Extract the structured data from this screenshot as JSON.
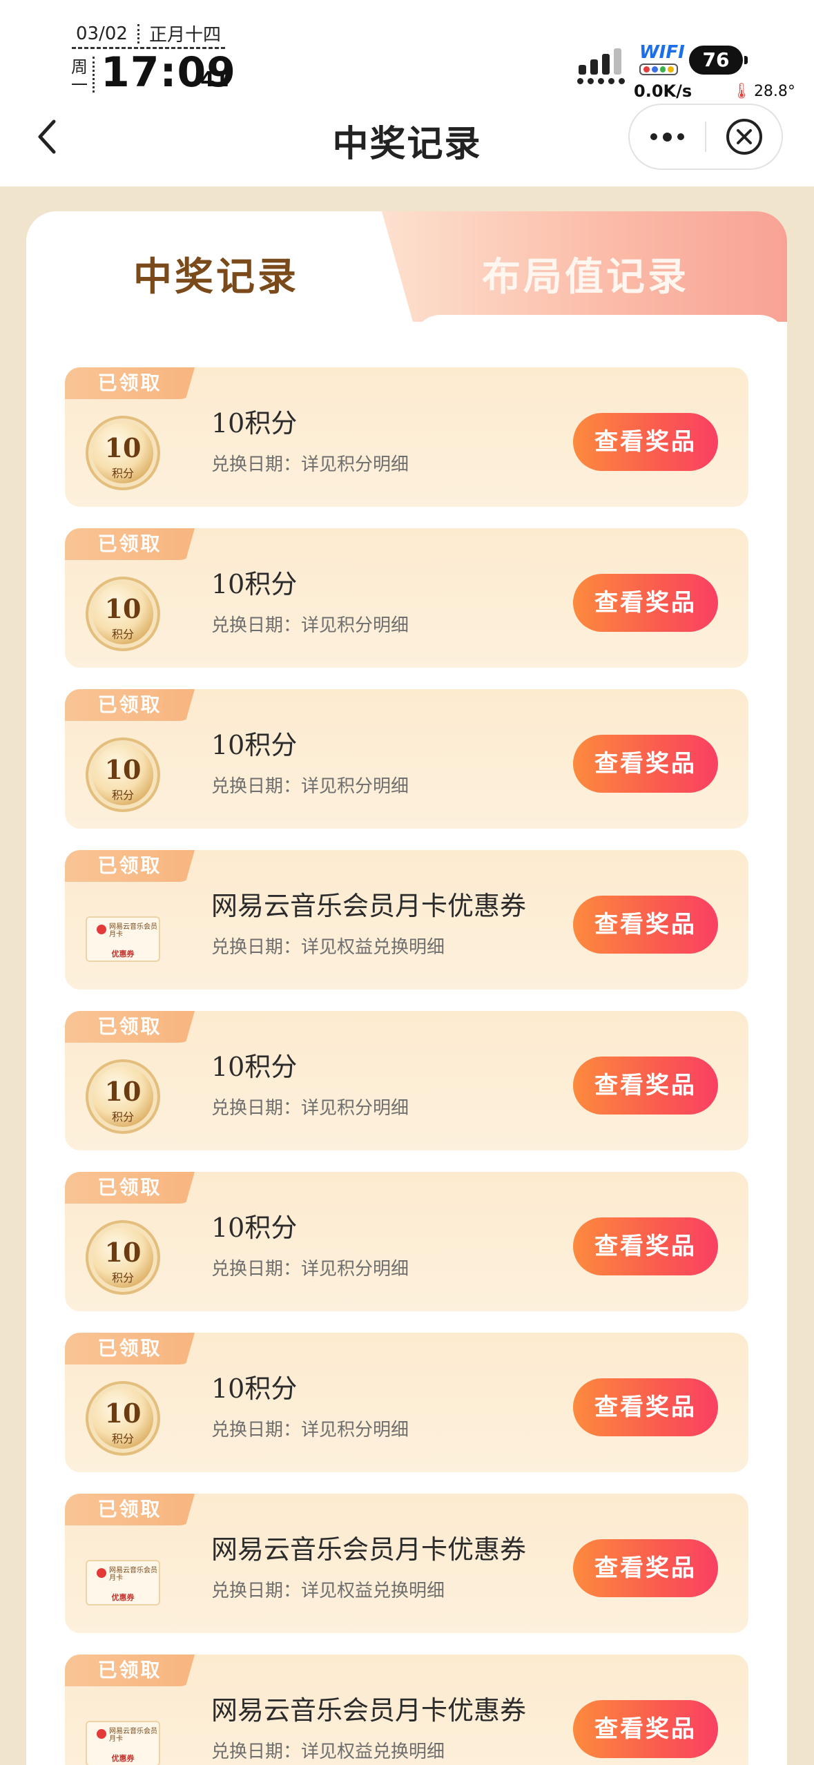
{
  "status_bar": {
    "date": "03/02",
    "lunar": "正月十四",
    "weekday": "周一",
    "time": "17:09",
    "seconds": "41",
    "wifi_label": "WIFI",
    "battery": "76",
    "net_speed": "0.0K/s",
    "temperature": "28.8°"
  },
  "header": {
    "title": "中奖记录"
  },
  "tabs": {
    "active": "中奖记录",
    "inactive": "布局值记录"
  },
  "voucher_thumb": {
    "name": "网易云音乐会员月卡",
    "tag": "优惠券"
  },
  "records": [
    {
      "type": "coin",
      "badge": "已领取",
      "coin_value": "10",
      "coin_unit": "积分",
      "title": "10积分",
      "subtitle": "兑换日期：详见积分明细",
      "button": "查看奖品"
    },
    {
      "type": "coin",
      "badge": "已领取",
      "coin_value": "10",
      "coin_unit": "积分",
      "title": "10积分",
      "subtitle": "兑换日期：详见积分明细",
      "button": "查看奖品"
    },
    {
      "type": "coin",
      "badge": "已领取",
      "coin_value": "10",
      "coin_unit": "积分",
      "title": "10积分",
      "subtitle": "兑换日期：详见积分明细",
      "button": "查看奖品"
    },
    {
      "type": "voucher",
      "badge": "已领取",
      "title": "网易云音乐会员月卡优惠券",
      "subtitle": "兑换日期：详见权益兑换明细",
      "button": "查看奖品"
    },
    {
      "type": "coin",
      "badge": "已领取",
      "coin_value": "10",
      "coin_unit": "积分",
      "title": "10积分",
      "subtitle": "兑换日期：详见积分明细",
      "button": "查看奖品"
    },
    {
      "type": "coin",
      "badge": "已领取",
      "coin_value": "10",
      "coin_unit": "积分",
      "title": "10积分",
      "subtitle": "兑换日期：详见积分明细",
      "button": "查看奖品"
    },
    {
      "type": "coin",
      "badge": "已领取",
      "coin_value": "10",
      "coin_unit": "积分",
      "title": "10积分",
      "subtitle": "兑换日期：详见积分明细",
      "button": "查看奖品"
    },
    {
      "type": "voucher",
      "badge": "已领取",
      "title": "网易云音乐会员月卡优惠券",
      "subtitle": "兑换日期：详见权益兑换明细",
      "button": "查看奖品"
    },
    {
      "type": "voucher",
      "badge": "已领取",
      "title": "网易云音乐会员月卡优惠券",
      "subtitle": "兑换日期：详见权益兑换明细",
      "button": "查看奖品"
    }
  ],
  "colors": {
    "accent_button": "#fb5b4f",
    "badge": "#f9c495",
    "page_background": "#f1e4cc",
    "active_tab_text": "#7a4a1a"
  }
}
